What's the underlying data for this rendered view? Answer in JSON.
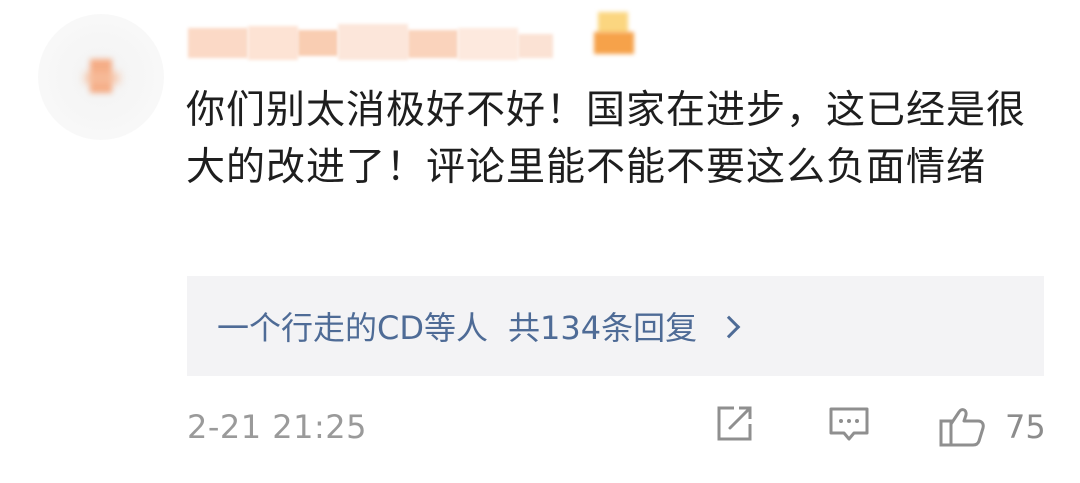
{
  "comment": {
    "avatar_icon": "avatar-icon",
    "username": "",
    "text": "你们别太消极好不好！国家在进步，这已经是很大的改进了！评论里能不能不要这么负面情绪",
    "replies": {
      "who": "一个行走的CD等人",
      "count_text": "共134条回复"
    },
    "timestamp": "2-21 21:25",
    "actions": {
      "share_icon": "share-icon",
      "reply_icon": "comment-icon",
      "like_icon": "thumbs-up-icon",
      "like_count": "75"
    },
    "colors": {
      "link": "#4e6b96",
      "meta": "#9a9a9a",
      "reply_bg": "#f3f3f5"
    }
  }
}
